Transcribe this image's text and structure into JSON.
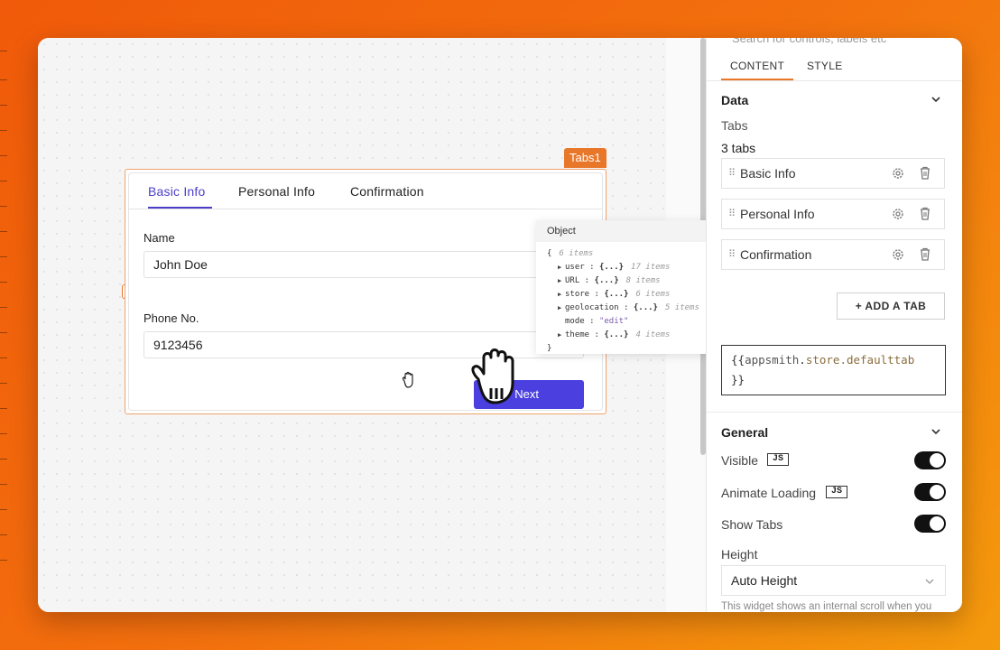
{
  "canvas": {
    "widget_name": "Tabs1",
    "tabs": [
      {
        "label": "Basic Info"
      },
      {
        "label": "Personal Info"
      },
      {
        "label": "Confirmation"
      }
    ],
    "form": {
      "name_label": "Name",
      "name_value": "John Doe",
      "phone_label": "Phone No.",
      "phone_value": "9123456",
      "next_button": "Next"
    }
  },
  "object_popover": {
    "title": "Object",
    "open_brace": "{",
    "summary": "6 items",
    "entries": [
      {
        "key": "user",
        "value": "{...}",
        "count": "17 items",
        "expandable": true
      },
      {
        "key": "URL",
        "value": "{...}",
        "count": "8 items",
        "expandable": true
      },
      {
        "key": "store",
        "value": "{...}",
        "count": "6 items",
        "expandable": true
      },
      {
        "key": "geolocation",
        "value": "{...}",
        "count": "5 items",
        "expandable": true
      },
      {
        "key": "mode",
        "value": "\"edit\"",
        "count": "",
        "expandable": false
      },
      {
        "key": "theme",
        "value": "{...}",
        "count": "4 items",
        "expandable": true
      }
    ],
    "close_brace": "}"
  },
  "panel": {
    "search_hint": "Search for controls, labels etc",
    "tabs": {
      "content": "CONTENT",
      "style": "STYLE"
    },
    "data_section": {
      "title": "Data",
      "tabs_label": "Tabs",
      "tabs_count": "3 tabs",
      "tab_items": [
        "Basic Info",
        "Personal Info",
        "Confirmation"
      ],
      "add_tab": "+ ADD A TAB",
      "default_tab_code": {
        "open": "{{",
        "obj": "appsmith",
        "prop": "store.defaulttab",
        "close": "}}"
      }
    },
    "general_section": {
      "title": "General",
      "visible": "Visible",
      "animate_loading": "Animate Loading",
      "show_tabs": "Show Tabs",
      "js_badge": "JS",
      "height_label": "Height",
      "height_value": "Auto Height",
      "help_text": "This widget shows an internal scroll when you"
    }
  },
  "colors": {
    "accent": "#4b3fc7",
    "button": "#4b3fe0",
    "widget_outline": "#e8772a",
    "background_start": "#f05a0a",
    "background_end": "#f49a0d"
  },
  "icons": [
    "chevron-down-icon",
    "gear-icon",
    "trash-icon",
    "drag-grip-icon",
    "grab-hand-cursor-icon"
  ]
}
